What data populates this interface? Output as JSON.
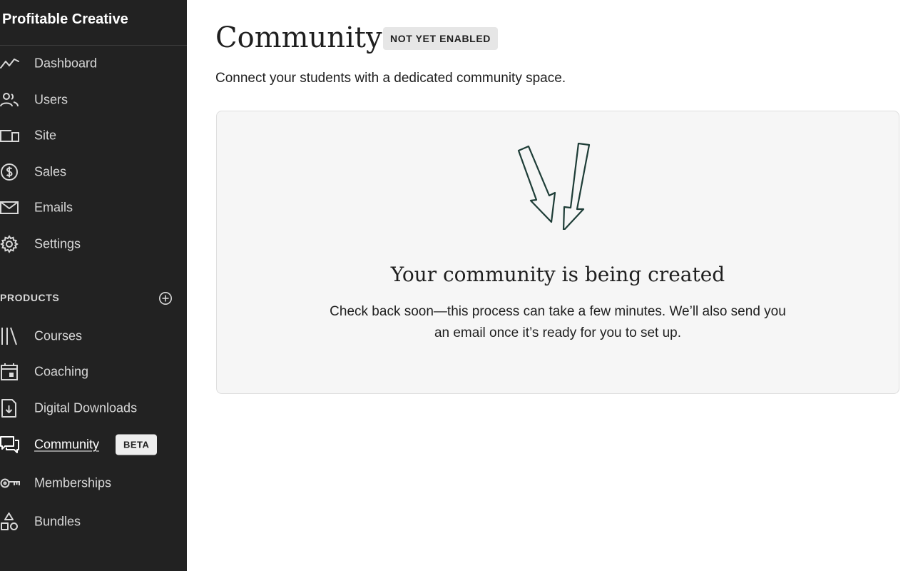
{
  "app": {
    "brand": "Profitable Creative"
  },
  "sidebar": {
    "main_items": [
      {
        "label": "Dashboard",
        "icon": "trend-line-icon"
      },
      {
        "label": "Users",
        "icon": "users-icon"
      },
      {
        "label": "Site",
        "icon": "devices-icon"
      },
      {
        "label": "Sales",
        "icon": "dollar-circle-icon"
      },
      {
        "label": "Emails",
        "icon": "envelope-icon"
      },
      {
        "label": "Settings",
        "icon": "gear-icon"
      }
    ],
    "products_label": "PRODUCTS",
    "product_items": [
      {
        "label": "Courses",
        "icon": "library-icon"
      },
      {
        "label": "Coaching",
        "icon": "calendar-icon"
      },
      {
        "label": "Digital Downloads",
        "icon": "file-download-icon"
      },
      {
        "label": "Community",
        "icon": "chat-bubbles-icon",
        "active": true,
        "badge": "BETA"
      },
      {
        "label": "Memberships",
        "icon": "key-icon"
      },
      {
        "label": "Bundles",
        "icon": "shapes-icon"
      }
    ]
  },
  "main": {
    "title": "Community",
    "status_badge": "NOT YET ENABLED",
    "subtitle": "Connect your students with a dedicated community space.",
    "panel": {
      "icon": "double-arrow-down-icon",
      "heading": "Your community is being created",
      "body_line1": "Check back soon—this process can take a few minutes. We’ll also send you",
      "body_line2": "an email once it’s ready for you to set up."
    }
  },
  "colors": {
    "sidebar_bg": "#222222",
    "badge_bg": "#e6e6e6",
    "panel_bg": "#f6f6f6",
    "arrow_stroke": "#1e3d37"
  }
}
